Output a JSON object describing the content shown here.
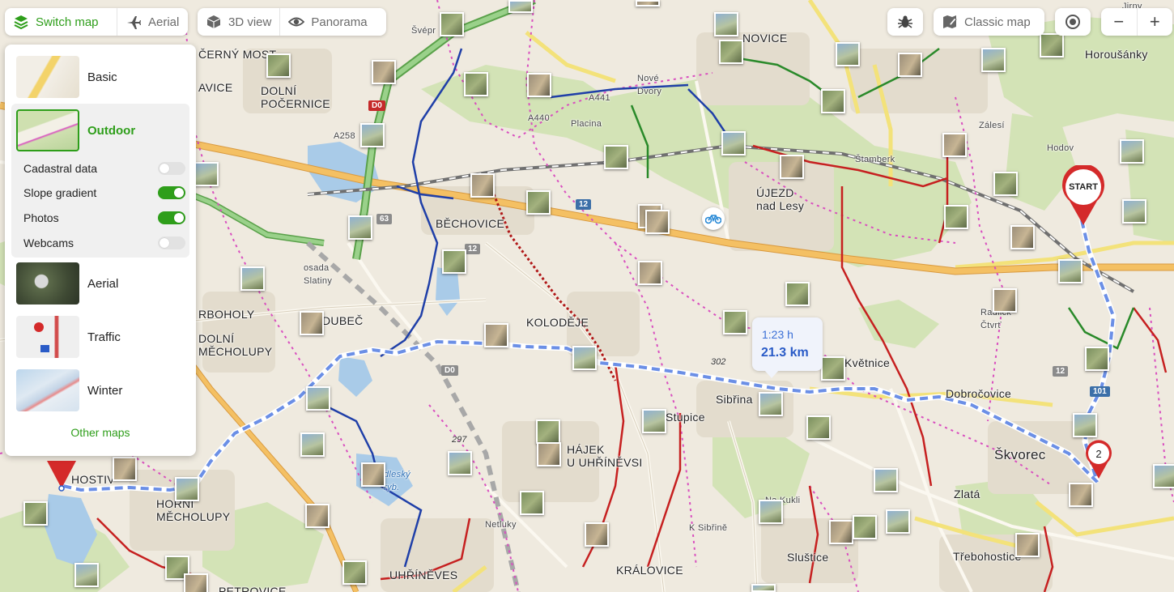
{
  "toolbar": {
    "switch_map": "Switch map",
    "aerial": "Aerial",
    "view3d": "3D view",
    "panorama": "Panorama",
    "classic_map": "Classic map",
    "zoom_out": "−",
    "zoom_in": "+"
  },
  "panel": {
    "maps": [
      {
        "label": "Basic"
      },
      {
        "label": "Outdoor",
        "selected": true
      },
      {
        "label": "Aerial"
      },
      {
        "label": "Traffic"
      },
      {
        "label": "Winter"
      }
    ],
    "options": [
      {
        "label": "Cadastral data",
        "on": false
      },
      {
        "label": "Slope gradient",
        "on": true
      },
      {
        "label": "Photos",
        "on": true
      },
      {
        "label": "Webcams",
        "on": false
      }
    ],
    "other_maps": "Other maps"
  },
  "route": {
    "time": "1:23 h",
    "distance": "21.3 km",
    "start_label": "START",
    "waypoint_label": "2"
  },
  "places": {
    "novice": "NOVICE",
    "horousanky": "Horoušánky",
    "cerny_most": "ČERNÝ MOST",
    "dolni_pocernice": "DOLNÍ\nPOČERNICE",
    "avice": "AVICE",
    "nove_dvory": "Nové\nDvory",
    "placina": "Placina",
    "zalesi": "Zálesí",
    "hodov": "Hodov",
    "stamberk": "Štamberk",
    "ujezd": "ÚJEZD\nnad Lesy",
    "bechovice": "BĚCHOVICE",
    "osada_slatiny": "osada\nSlatiny",
    "rboholy": "RBOHOLY",
    "dolni_mecholupy": "DOLNÍ\nMĚCHOLUPY",
    "dubec": "DUBEČ",
    "kolodeje": "KOLODĚJE",
    "radlick_ctvrt": "Radlick\nČtvrť",
    "kvetnice": "Květnice",
    "sibrina": "Sibřina",
    "stupice": "Stupice",
    "dobrocovice": "Dobročovice",
    "skvorec": "Škvorec",
    "hostiv": "HOSTIV",
    "horni_mecholupy": "HORNÍ\nMĚCHOLUPY",
    "hajek": "HÁJEK\nU UHŘÍNĚVSI",
    "zlata": "Zlatá",
    "na_kukli": "Na Kukli",
    "k_sibrine": "K Sibřině",
    "netluky": "Netluky",
    "slustice": "Sluštice",
    "trebohostice": "Třebohostice",
    "kralovice": "KRÁLOVICE",
    "uhrineves": "UHŘÍNĚVES",
    "petrovice": "PETROVICE",
    "jirny": "Jirny",
    "svepr": "Švépr",
    "dlesky_ryb": "dleský\nryb."
  },
  "elevations": {
    "e302": "302",
    "e297": "297"
  },
  "shields": {
    "d0a": "D0",
    "d0b": "D0",
    "r12a": "12",
    "r12b": "12",
    "r12c": "12",
    "r63": "63",
    "r101": "101",
    "a258": "A258",
    "a441": "A441",
    "a440": "A440"
  },
  "colors": {
    "accent_green": "#2e9e1a",
    "route_blue": "#6b8fe6",
    "trail_red": "#c62020",
    "trail_blue": "#1f3fa8",
    "trail_green": "#2a8a2a",
    "boundary_pink": "#d94fbf",
    "road_orange": "#f0b25a",
    "forest": "#cfe0b0",
    "water": "#a9cbe8"
  }
}
